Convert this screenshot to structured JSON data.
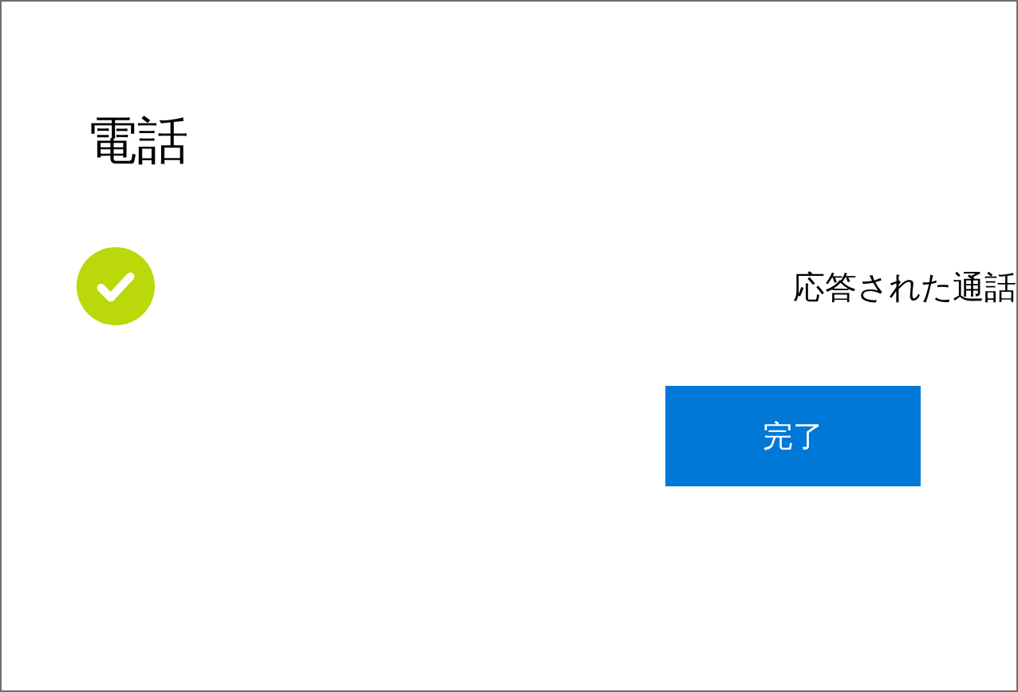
{
  "title": "電話",
  "status": {
    "kind": "success",
    "text": "応答された通話"
  },
  "buttons": [
    {
      "label": "完了",
      "kind": "primary"
    }
  ]
}
